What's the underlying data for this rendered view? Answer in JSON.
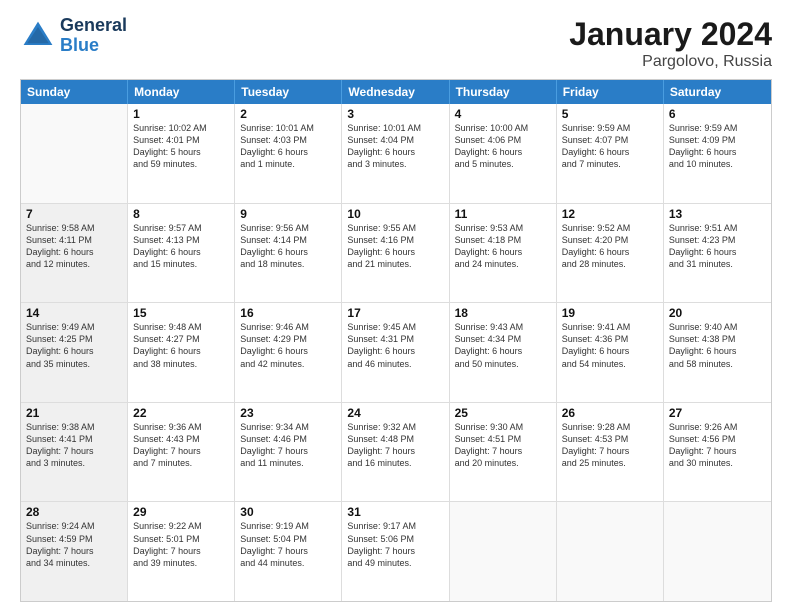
{
  "header": {
    "logo_general": "General",
    "logo_blue": "Blue",
    "main_title": "January 2024",
    "subtitle": "Pargolovo, Russia"
  },
  "calendar": {
    "days_of_week": [
      "Sunday",
      "Monday",
      "Tuesday",
      "Wednesday",
      "Thursday",
      "Friday",
      "Saturday"
    ],
    "rows": [
      [
        {
          "day": "",
          "empty": true
        },
        {
          "day": "1",
          "lines": [
            "Sunrise: 10:02 AM",
            "Sunset: 4:01 PM",
            "Daylight: 5 hours",
            "and 59 minutes."
          ]
        },
        {
          "day": "2",
          "lines": [
            "Sunrise: 10:01 AM",
            "Sunset: 4:03 PM",
            "Daylight: 6 hours",
            "and 1 minute."
          ]
        },
        {
          "day": "3",
          "lines": [
            "Sunrise: 10:01 AM",
            "Sunset: 4:04 PM",
            "Daylight: 6 hours",
            "and 3 minutes."
          ]
        },
        {
          "day": "4",
          "lines": [
            "Sunrise: 10:00 AM",
            "Sunset: 4:06 PM",
            "Daylight: 6 hours",
            "and 5 minutes."
          ]
        },
        {
          "day": "5",
          "lines": [
            "Sunrise: 9:59 AM",
            "Sunset: 4:07 PM",
            "Daylight: 6 hours",
            "and 7 minutes."
          ]
        },
        {
          "day": "6",
          "lines": [
            "Sunrise: 9:59 AM",
            "Sunset: 4:09 PM",
            "Daylight: 6 hours",
            "and 10 minutes."
          ]
        }
      ],
      [
        {
          "day": "7",
          "lines": [
            "Sunrise: 9:58 AM",
            "Sunset: 4:11 PM",
            "Daylight: 6 hours",
            "and 12 minutes."
          ],
          "shaded": true
        },
        {
          "day": "8",
          "lines": [
            "Sunrise: 9:57 AM",
            "Sunset: 4:13 PM",
            "Daylight: 6 hours",
            "and 15 minutes."
          ]
        },
        {
          "day": "9",
          "lines": [
            "Sunrise: 9:56 AM",
            "Sunset: 4:14 PM",
            "Daylight: 6 hours",
            "and 18 minutes."
          ]
        },
        {
          "day": "10",
          "lines": [
            "Sunrise: 9:55 AM",
            "Sunset: 4:16 PM",
            "Daylight: 6 hours",
            "and 21 minutes."
          ]
        },
        {
          "day": "11",
          "lines": [
            "Sunrise: 9:53 AM",
            "Sunset: 4:18 PM",
            "Daylight: 6 hours",
            "and 24 minutes."
          ]
        },
        {
          "day": "12",
          "lines": [
            "Sunrise: 9:52 AM",
            "Sunset: 4:20 PM",
            "Daylight: 6 hours",
            "and 28 minutes."
          ]
        },
        {
          "day": "13",
          "lines": [
            "Sunrise: 9:51 AM",
            "Sunset: 4:23 PM",
            "Daylight: 6 hours",
            "and 31 minutes."
          ]
        }
      ],
      [
        {
          "day": "14",
          "lines": [
            "Sunrise: 9:49 AM",
            "Sunset: 4:25 PM",
            "Daylight: 6 hours",
            "and 35 minutes."
          ],
          "shaded": true
        },
        {
          "day": "15",
          "lines": [
            "Sunrise: 9:48 AM",
            "Sunset: 4:27 PM",
            "Daylight: 6 hours",
            "and 38 minutes."
          ]
        },
        {
          "day": "16",
          "lines": [
            "Sunrise: 9:46 AM",
            "Sunset: 4:29 PM",
            "Daylight: 6 hours",
            "and 42 minutes."
          ]
        },
        {
          "day": "17",
          "lines": [
            "Sunrise: 9:45 AM",
            "Sunset: 4:31 PM",
            "Daylight: 6 hours",
            "and 46 minutes."
          ]
        },
        {
          "day": "18",
          "lines": [
            "Sunrise: 9:43 AM",
            "Sunset: 4:34 PM",
            "Daylight: 6 hours",
            "and 50 minutes."
          ]
        },
        {
          "day": "19",
          "lines": [
            "Sunrise: 9:41 AM",
            "Sunset: 4:36 PM",
            "Daylight: 6 hours",
            "and 54 minutes."
          ]
        },
        {
          "day": "20",
          "lines": [
            "Sunrise: 9:40 AM",
            "Sunset: 4:38 PM",
            "Daylight: 6 hours",
            "and 58 minutes."
          ]
        }
      ],
      [
        {
          "day": "21",
          "lines": [
            "Sunrise: 9:38 AM",
            "Sunset: 4:41 PM",
            "Daylight: 7 hours",
            "and 3 minutes."
          ],
          "shaded": true
        },
        {
          "day": "22",
          "lines": [
            "Sunrise: 9:36 AM",
            "Sunset: 4:43 PM",
            "Daylight: 7 hours",
            "and 7 minutes."
          ]
        },
        {
          "day": "23",
          "lines": [
            "Sunrise: 9:34 AM",
            "Sunset: 4:46 PM",
            "Daylight: 7 hours",
            "and 11 minutes."
          ]
        },
        {
          "day": "24",
          "lines": [
            "Sunrise: 9:32 AM",
            "Sunset: 4:48 PM",
            "Daylight: 7 hours",
            "and 16 minutes."
          ]
        },
        {
          "day": "25",
          "lines": [
            "Sunrise: 9:30 AM",
            "Sunset: 4:51 PM",
            "Daylight: 7 hours",
            "and 20 minutes."
          ]
        },
        {
          "day": "26",
          "lines": [
            "Sunrise: 9:28 AM",
            "Sunset: 4:53 PM",
            "Daylight: 7 hours",
            "and 25 minutes."
          ]
        },
        {
          "day": "27",
          "lines": [
            "Sunrise: 9:26 AM",
            "Sunset: 4:56 PM",
            "Daylight: 7 hours",
            "and 30 minutes."
          ]
        }
      ],
      [
        {
          "day": "28",
          "lines": [
            "Sunrise: 9:24 AM",
            "Sunset: 4:59 PM",
            "Daylight: 7 hours",
            "and 34 minutes."
          ],
          "shaded": true
        },
        {
          "day": "29",
          "lines": [
            "Sunrise: 9:22 AM",
            "Sunset: 5:01 PM",
            "Daylight: 7 hours",
            "and 39 minutes."
          ]
        },
        {
          "day": "30",
          "lines": [
            "Sunrise: 9:19 AM",
            "Sunset: 5:04 PM",
            "Daylight: 7 hours",
            "and 44 minutes."
          ]
        },
        {
          "day": "31",
          "lines": [
            "Sunrise: 9:17 AM",
            "Sunset: 5:06 PM",
            "Daylight: 7 hours",
            "and 49 minutes."
          ]
        },
        {
          "day": "",
          "empty": true
        },
        {
          "day": "",
          "empty": true
        },
        {
          "day": "",
          "empty": true
        }
      ]
    ]
  }
}
